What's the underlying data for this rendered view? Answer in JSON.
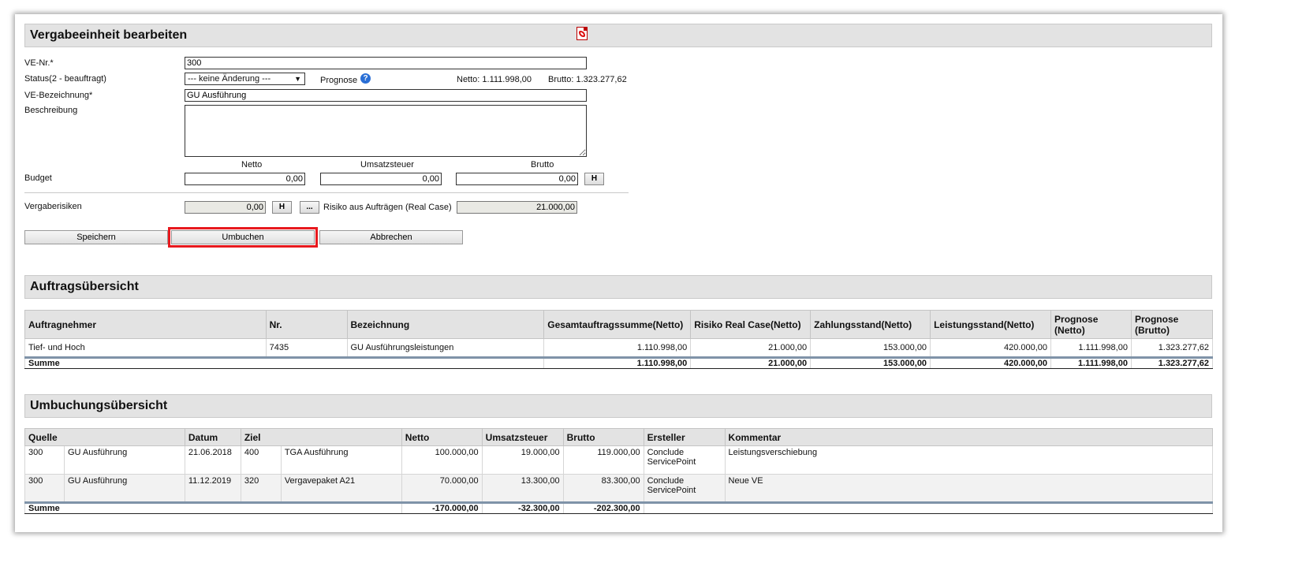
{
  "edit": {
    "title": "Vergabeeinheit bearbeiten",
    "ve_nr_label": "VE-Nr.*",
    "ve_nr_value": "300",
    "status_label": "Status(2 - beauftragt)",
    "status_value": "--- keine Änderung ---",
    "prognose_label": "Prognose",
    "netto_text": "Netto: 1.111.998,00",
    "brutto_text": "Brutto: 1.323.277,62",
    "bezeichnung_label": "VE-Bezeichnung*",
    "bezeichnung_value": "GU Ausführung",
    "beschreibung_label": "Beschreibung",
    "beschreibung_value": "",
    "col_netto": "Netto",
    "col_ust": "Umsatzsteuer",
    "col_brutto": "Brutto",
    "budget_label": "Budget",
    "budget_netto": "0,00",
    "budget_ust": "0,00",
    "budget_brutto": "0,00",
    "h_label": "H",
    "vergaberisiken_label": "Vergaberisiken",
    "vergaberisiken_value": "0,00",
    "dots_label": "...",
    "risiko_label": "Risiko aus Aufträgen (Real Case)",
    "risiko_value": "21.000,00",
    "save_label": "Speichern",
    "umbuchen_label": "Umbuchen",
    "cancel_label": "Abbrechen"
  },
  "auftraege": {
    "title": "Auftragsübersicht",
    "headers": [
      "Auftragnehmer",
      "Nr.",
      "Bezeichnung",
      "Gesamtauftragssumme(Netto)",
      "Risiko Real Case(Netto)",
      "Zahlungsstand(Netto)",
      "Leistungsstand(Netto)",
      "Prognose (Netto)",
      "Prognose (Brutto)"
    ],
    "rows": [
      [
        "Tief- und Hoch",
        "7435",
        "GU Ausführungsleistungen",
        "1.110.998,00",
        "21.000,00",
        "153.000,00",
        "420.000,00",
        "1.111.998,00",
        "1.323.277,62"
      ]
    ],
    "sum_label": "Summe",
    "sum": [
      "1.110.998,00",
      "21.000,00",
      "153.000,00",
      "420.000,00",
      "1.111.998,00",
      "1.323.277,62"
    ]
  },
  "umbuchungen": {
    "title": "Umbuchungsübersicht",
    "headers": [
      "Quelle",
      "Datum",
      "Ziel",
      "Netto",
      "Umsatzsteuer",
      "Brutto",
      "Ersteller",
      "Kommentar"
    ],
    "rows": [
      [
        "300",
        "GU Ausführung",
        "21.06.2018",
        "400",
        "TGA Ausführung",
        "100.000,00",
        "19.000,00",
        "119.000,00",
        "Conclude ServicePoint",
        "Leistungsverschiebung"
      ],
      [
        "300",
        "GU Ausführung",
        "11.12.2019",
        "320",
        "Vergavepaket A21",
        "70.000,00",
        "13.300,00",
        "83.300,00",
        "Conclude ServicePoint",
        "Neue VE"
      ]
    ],
    "sum_label": "Summe",
    "sum": [
      "-170.000,00",
      "-32.300,00",
      "-202.300,00"
    ]
  },
  "icons": {
    "pdf": "pdf-icon",
    "help": "help-icon"
  },
  "colors": {
    "highlight": "#e8191e",
    "header_bg": "#e3e3e3",
    "help_icon": "#2a6fd6"
  }
}
